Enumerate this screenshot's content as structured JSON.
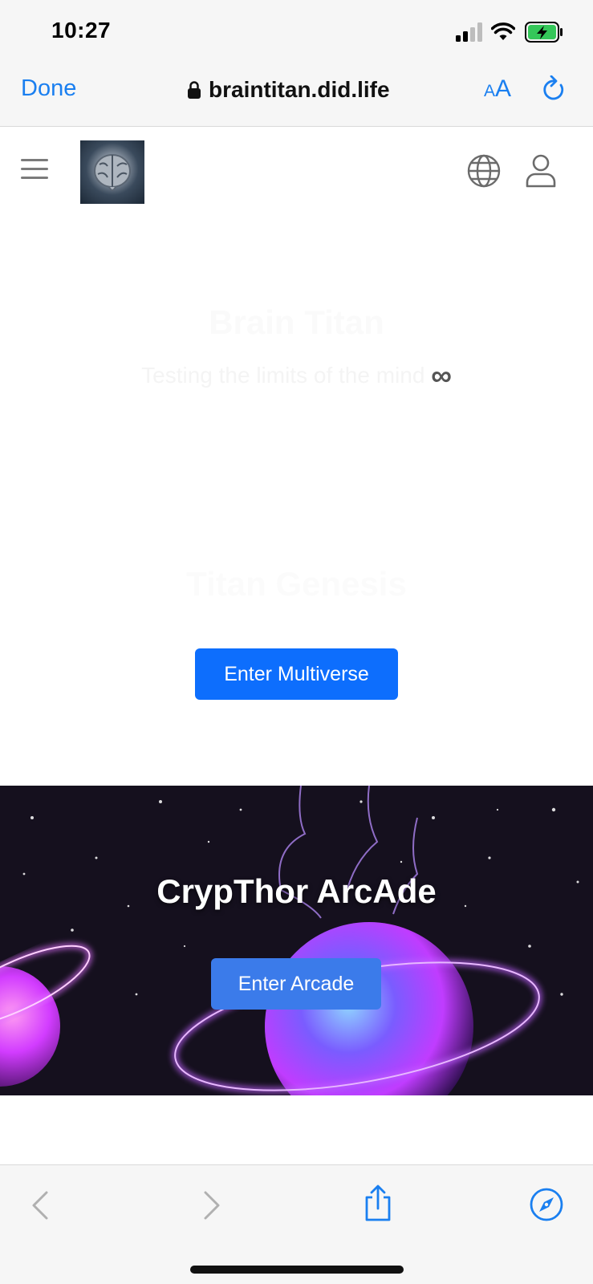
{
  "status_bar": {
    "time": "10:27",
    "icons": [
      "cellular-signal-icon",
      "wifi-icon",
      "battery-charging-icon"
    ]
  },
  "browser": {
    "done_label": "Done",
    "url": "braintitan.did.life",
    "text_size_label": "AA",
    "icons": [
      "lock-icon",
      "reload-icon"
    ]
  },
  "site_header": {
    "icons": [
      "hamburger-menu-icon",
      "brain-logo",
      "globe-icon",
      "user-icon"
    ]
  },
  "hero": {
    "title": "Brain Titan",
    "subtitle": "Testing the limits of the mind",
    "subtitle_symbol": "∞"
  },
  "genesis": {
    "title": "Titan Genesis",
    "button_label": "Enter Multiverse"
  },
  "arcade": {
    "title": "CrypThor ArcAde",
    "button_label": "Enter Arcade"
  },
  "toolbar": {
    "icons": [
      "back-icon",
      "forward-icon",
      "share-icon",
      "compass-icon"
    ]
  },
  "colors": {
    "accent": "#1a7ff0",
    "button_primary": "#0d6efd",
    "arcade_button": "#3b7bea",
    "arcade_glow": "#b03cff"
  }
}
